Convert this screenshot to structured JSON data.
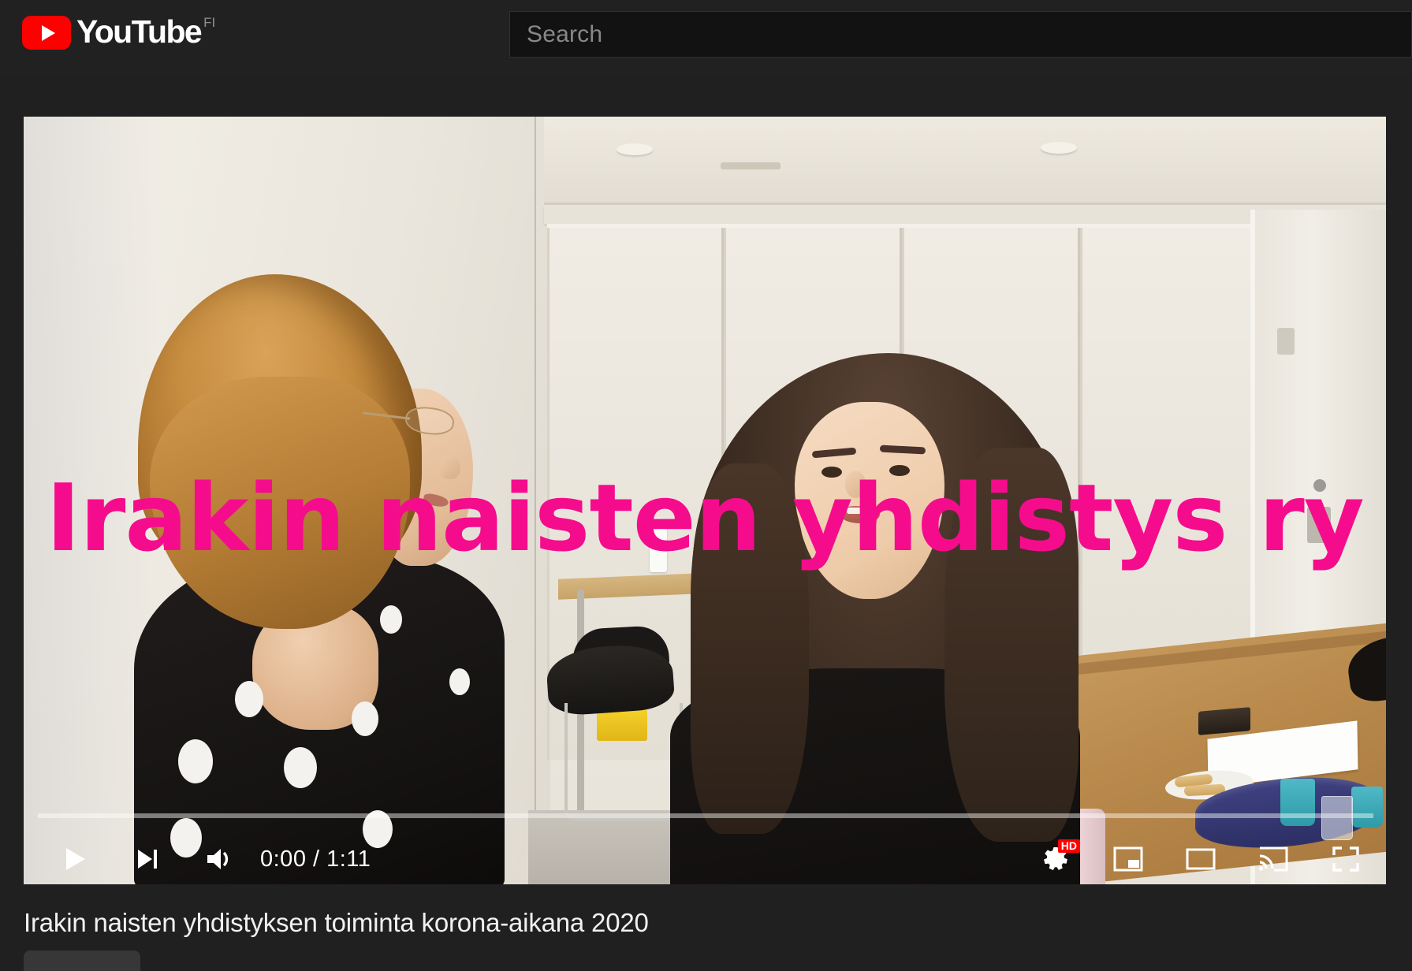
{
  "header": {
    "logo_text": "YouTube",
    "logo_icon": "youtube-play-icon",
    "country_code": "FI",
    "search_placeholder": "Search"
  },
  "player": {
    "overlay_text": "Irakin naisten yhdistys ry",
    "overlay_color": "#F50C8C",
    "time_display": "0:00 / 1:11",
    "current_time": "0:00",
    "duration": "1:11",
    "progress_percent": 0,
    "quality_badge": "HD",
    "progress_color": "#FF0000",
    "controls": {
      "play": "play-button",
      "next": "next-video-button",
      "volume": "volume-button",
      "settings": "settings-gear-button",
      "miniplayer": "miniplayer-button",
      "theater": "theater-mode-button",
      "cast": "cast-button",
      "fullscreen": "fullscreen-button"
    }
  },
  "video": {
    "title": "Irakin naisten yhdistyksen toiminta korona-aikana 2020"
  }
}
